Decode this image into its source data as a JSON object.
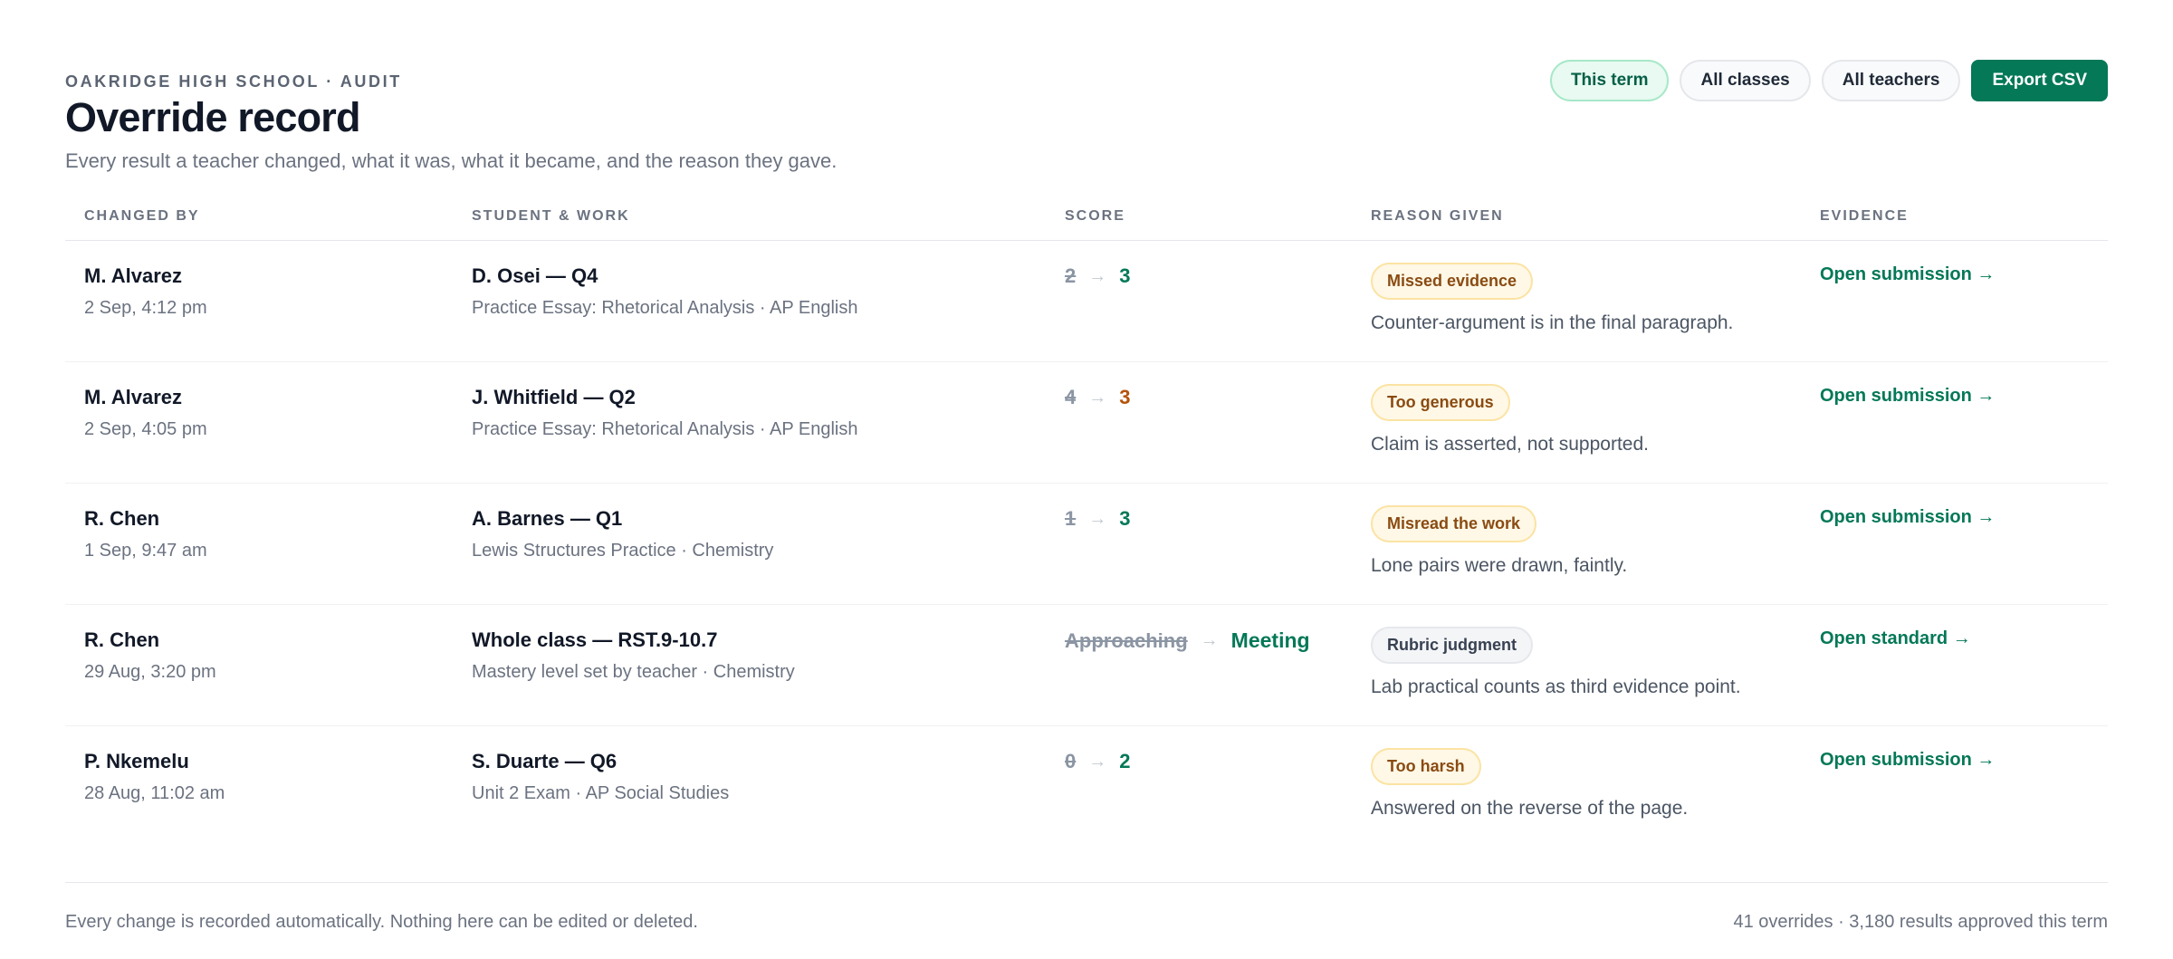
{
  "header": {
    "eyebrow": "OAKRIDGE HIGH SCHOOL · AUDIT",
    "title": "Override record",
    "subtitle": "Every result a teacher changed, what it was, what it became, and the reason they gave."
  },
  "filters": {
    "term": "This term",
    "classes": "All classes",
    "teachers": "All teachers",
    "export": "Export CSV"
  },
  "columns": {
    "changed_by": "CHANGED BY",
    "student_work": "STUDENT & WORK",
    "score": "SCORE",
    "reason": "REASON GIVEN",
    "evidence": "EVIDENCE"
  },
  "arrow_glyph": "→",
  "rows": [
    {
      "teacher": "M. Alvarez",
      "time": "2 Sep, 4:12 pm",
      "student": "D. Osei — Q4",
      "work": "Practice Essay: Rhetorical Analysis · AP English",
      "old": "2",
      "new": "3",
      "reason_tag": "Missed evidence",
      "reason": "Counter-argument is in the final paragraph.",
      "evidence": "Open submission →"
    },
    {
      "teacher": "M. Alvarez",
      "time": "2 Sep, 4:05 pm",
      "student": "J. Whitfield — Q2",
      "work": "Practice Essay: Rhetorical Analysis · AP English",
      "old": "4",
      "new": "3",
      "reason_tag": "Too generous",
      "reason": "Claim is asserted, not supported.",
      "evidence": "Open submission →"
    },
    {
      "teacher": "R. Chen",
      "time": "1 Sep, 9:47 am",
      "student": "A. Barnes — Q1",
      "work": "Lewis Structures Practice · Chemistry",
      "old": "1",
      "new": "3",
      "reason_tag": "Misread the work",
      "reason": "Lone pairs were drawn, faintly.",
      "evidence": "Open submission →"
    },
    {
      "teacher": "R. Chen",
      "time": "29 Aug, 3:20 pm",
      "student": "Whole class — RST.9-10.7",
      "work": "Mastery level set by teacher · Chemistry",
      "old": "Approaching",
      "new": "Meeting",
      "reason_tag": "Rubric judgment",
      "reason": "Lab practical counts as third evidence point.",
      "evidence": "Open standard →"
    },
    {
      "teacher": "P. Nkemelu",
      "time": "28 Aug, 11:02 am",
      "student": "S. Duarte — Q6",
      "work": "Unit 2 Exam · AP Social Studies",
      "old": "0",
      "new": "2",
      "reason_tag": "Too harsh",
      "reason": "Answered on the reverse of the page.",
      "evidence": "Open submission →"
    }
  ],
  "footer": {
    "note": "Every change is recorded automatically. Nothing here can be edited or deleted.",
    "summary": "41 overrides · 3,180 results approved this term"
  },
  "colors": {
    "accent": "#047857",
    "decrease": "#b45309",
    "badge_warm_bg": "#fff8e6",
    "badge_neutral_bg": "#f4f5f7"
  }
}
